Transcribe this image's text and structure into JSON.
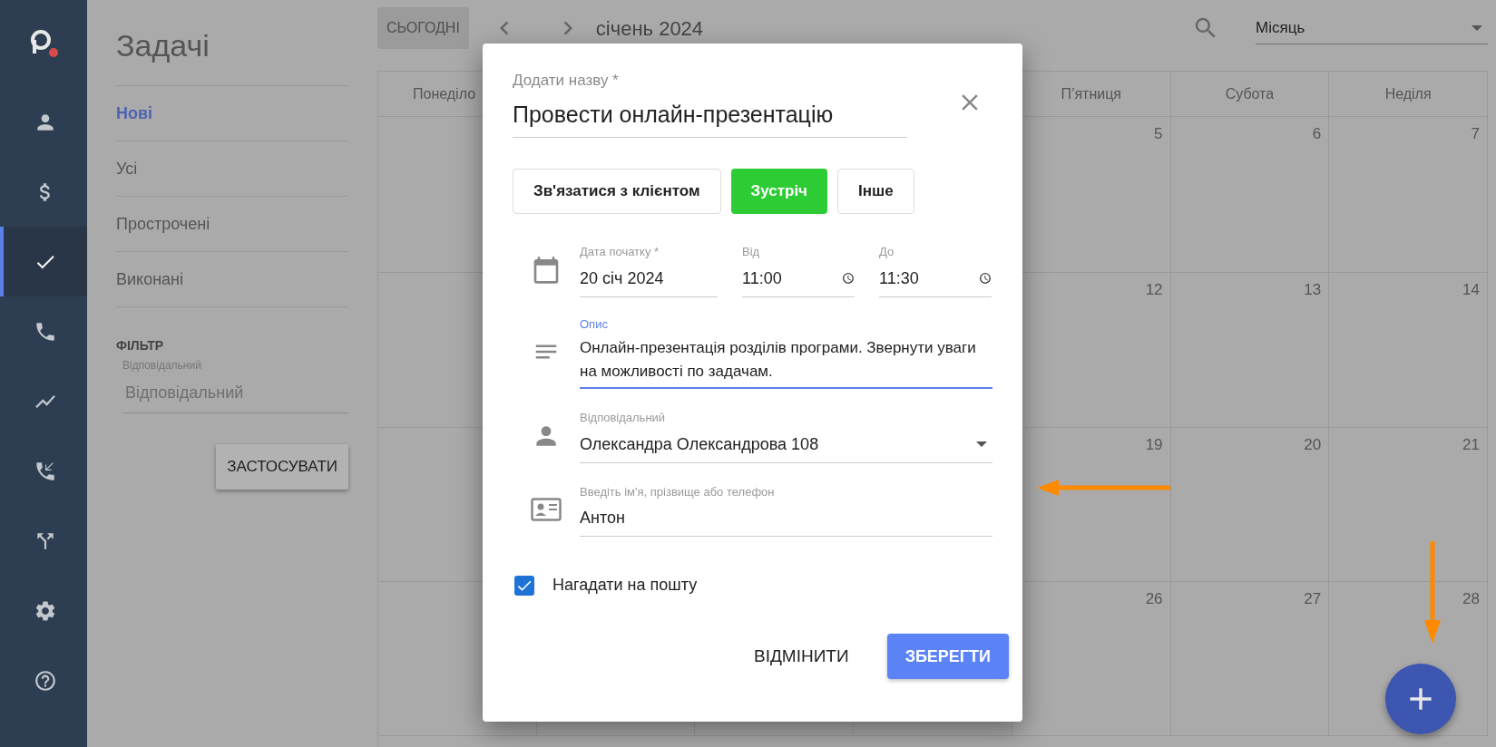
{
  "sidebar": {
    "items": [
      {
        "selected": false
      },
      {
        "selected": false
      },
      {
        "selected": true
      },
      {
        "selected": false
      },
      {
        "selected": false
      },
      {
        "selected": false
      },
      {
        "selected": false
      },
      {
        "selected": false
      },
      {
        "selected": false
      }
    ]
  },
  "tasks_panel": {
    "title": "Задачі",
    "filters": [
      {
        "label": "Нові",
        "selected": true
      },
      {
        "label": "Усі",
        "selected": false
      },
      {
        "label": "Прострочені",
        "selected": false
      },
      {
        "label": "Виконані",
        "selected": false
      }
    ],
    "filter_heading": "ФІЛЬТР",
    "responsible_field": {
      "label": "Відповідальний",
      "placeholder": "Відповідальний"
    },
    "apply_button": "ЗАСТОСУВАТИ"
  },
  "calendar": {
    "today_button": {
      "label": "СЬОГОДНІ",
      "disabled": true
    },
    "month": "січень 2024",
    "view_select": "Місяць",
    "weekday_headers": [
      "Понеділо",
      "П’ятниця",
      "Субота",
      "Неділя"
    ],
    "weeks": [
      [
        "5",
        "6",
        "7"
      ],
      [
        "12",
        "13",
        "14"
      ],
      [
        "19",
        "20",
        "21"
      ],
      [
        "26",
        "27",
        "28"
      ]
    ]
  },
  "dialog": {
    "title_label": "Додати назву *",
    "title_value": "Провести онлайн-презентацію",
    "types": [
      {
        "label": "Зв'язатися з клієнтом",
        "selected": false
      },
      {
        "label": "Зустріч",
        "selected": true
      },
      {
        "label": "Інше",
        "selected": false
      }
    ],
    "start_date": {
      "label": "Дата початку *",
      "value": "20 січ 2024"
    },
    "time_from": {
      "label": "Від",
      "value": "11:00"
    },
    "time_to": {
      "label": "До",
      "value": "11:30"
    },
    "description": {
      "label": "Опис",
      "value": "Онлайн-презентація розділів програми. Звернути уваги на можливості по задачам.",
      "focused": true
    },
    "responsible": {
      "label": "Відповідальний",
      "value": "Олександра Олександрова 108"
    },
    "contact": {
      "label": "Введіть ім'я, прізвище або телефон",
      "value": "Антон"
    },
    "reminder": {
      "label": "Нагадати на пошту",
      "checked": true
    },
    "cancel_button": "ВІДМІНИТИ",
    "save_button": "ЗБЕРЕГТИ"
  }
}
